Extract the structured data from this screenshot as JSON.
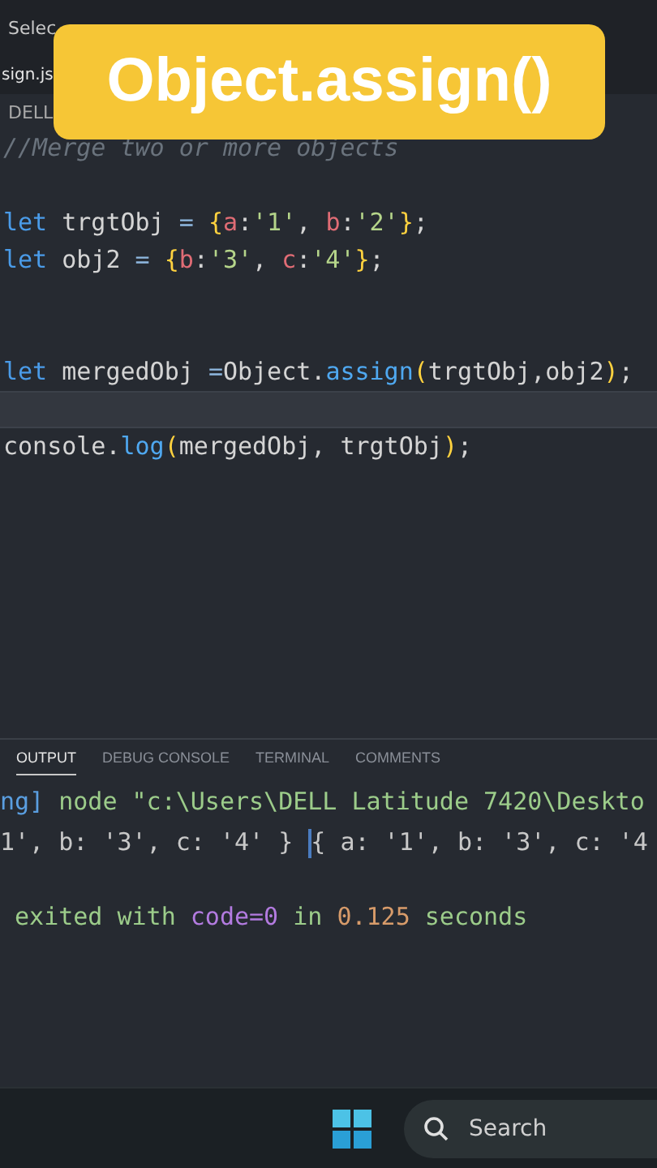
{
  "menu_bar": {
    "items": [
      "Selec"
    ]
  },
  "editor_tab": {
    "label": "sign.js"
  },
  "breadcrumb": {
    "label": "DELL"
  },
  "banner": {
    "title": "Object.assign()"
  },
  "code_lines": [
    {
      "kind": "code",
      "current": false,
      "tokens": [
        {
          "kind": "comment",
          "text": "//Merge two or more objects"
        }
      ]
    },
    {
      "kind": "blank",
      "current": false
    },
    {
      "kind": "code",
      "current": false,
      "tokens": [
        {
          "kind": "keyword",
          "text": "let"
        },
        {
          "kind": "plain",
          "text": " trgtObj"
        },
        {
          "kind": "operator",
          "text": " = "
        },
        {
          "kind": "bracket",
          "text": "{"
        },
        {
          "kind": "property",
          "text": "a"
        },
        {
          "kind": "plain",
          "text": ":"
        },
        {
          "kind": "string",
          "text": "'1'"
        },
        {
          "kind": "plain",
          "text": ", "
        },
        {
          "kind": "property",
          "text": "b"
        },
        {
          "kind": "plain",
          "text": ":"
        },
        {
          "kind": "string",
          "text": "'2'"
        },
        {
          "kind": "bracket",
          "text": "}"
        },
        {
          "kind": "plain",
          "text": ";"
        }
      ]
    },
    {
      "kind": "code",
      "current": false,
      "tokens": [
        {
          "kind": "keyword",
          "text": "let"
        },
        {
          "kind": "plain",
          "text": " obj2"
        },
        {
          "kind": "operator",
          "text": " = "
        },
        {
          "kind": "bracket",
          "text": "{"
        },
        {
          "kind": "property",
          "text": "b"
        },
        {
          "kind": "plain",
          "text": ":"
        },
        {
          "kind": "string",
          "text": "'3'"
        },
        {
          "kind": "plain",
          "text": ", "
        },
        {
          "kind": "property",
          "text": "c"
        },
        {
          "kind": "plain",
          "text": ":"
        },
        {
          "kind": "string",
          "text": "'4'"
        },
        {
          "kind": "bracket",
          "text": "}"
        },
        {
          "kind": "plain",
          "text": ";"
        }
      ]
    },
    {
      "kind": "blank",
      "current": false
    },
    {
      "kind": "blank",
      "current": false
    },
    {
      "kind": "code",
      "current": false,
      "tokens": [
        {
          "kind": "keyword",
          "text": "let"
        },
        {
          "kind": "plain",
          "text": " mergedObj "
        },
        {
          "kind": "operator",
          "text": "="
        },
        {
          "kind": "plain",
          "text": "Object."
        },
        {
          "kind": "function",
          "text": "assign"
        },
        {
          "kind": "bracket",
          "text": "("
        },
        {
          "kind": "plain",
          "text": "trgtObj,obj2"
        },
        {
          "kind": "bracket",
          "text": ")"
        },
        {
          "kind": "plain",
          "text": ";"
        }
      ]
    },
    {
      "kind": "blank",
      "current": true
    },
    {
      "kind": "code",
      "current": false,
      "tokens": [
        {
          "kind": "plain",
          "text": "console."
        },
        {
          "kind": "function",
          "text": "log"
        },
        {
          "kind": "bracket",
          "text": "("
        },
        {
          "kind": "plain",
          "text": "mergedObj, trgtObj"
        },
        {
          "kind": "bracket",
          "text": ")"
        },
        {
          "kind": "plain",
          "text": ";"
        }
      ]
    }
  ],
  "panel_tabs": [
    {
      "label": "OUTPUT",
      "selected": true
    },
    {
      "label": "DEBUG CONSOLE",
      "selected": false
    },
    {
      "label": "TERMINAL",
      "selected": false
    },
    {
      "label": "COMMENTS",
      "selected": false
    }
  ],
  "output_lines": [
    {
      "kind": "text",
      "segments": [
        {
          "kind": "info",
          "text": "ng]"
        },
        {
          "kind": "message",
          "text": " node \"c:\\Users\\DELL Latitude 7420\\Deskto"
        }
      ]
    },
    {
      "kind": "text",
      "segments": [
        {
          "kind": "plain",
          "text": "1', b: '3', c: '4' } "
        },
        {
          "kind": "cursor"
        },
        {
          "kind": "plain",
          "text": "{ a: '1', b: '3', c: '4"
        }
      ]
    },
    {
      "kind": "blank"
    },
    {
      "kind": "text",
      "segments": [
        {
          "kind": "message",
          "text": " exited with "
        },
        {
          "kind": "code",
          "text": "code=0"
        },
        {
          "kind": "message",
          "text": " in "
        },
        {
          "kind": "number",
          "text": "0.125"
        },
        {
          "kind": "message",
          "text": " seconds"
        }
      ]
    }
  ],
  "taskbar": {
    "search": {
      "placeholder": "Search"
    }
  }
}
